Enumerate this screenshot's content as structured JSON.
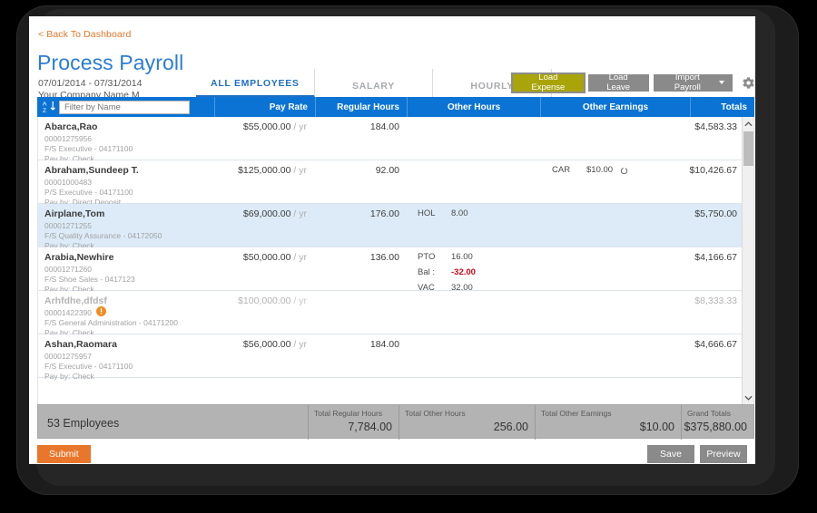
{
  "header": {
    "back_link": "< Back To Dashboard",
    "title": "Process Payroll",
    "date_range": "07/01/2014 - 07/31/2014",
    "company": "Your Company Name M"
  },
  "tabs": [
    {
      "label": "ALL EMPLOYEES",
      "active": true
    },
    {
      "label": "SALARY",
      "active": false
    },
    {
      "label": "HOURLY",
      "active": false
    }
  ],
  "actions": {
    "load_expense": "Load Expense",
    "load_leave": "Load Leave",
    "import_payroll": "Import Payroll",
    "gear": "gear-icon"
  },
  "filter": {
    "placeholder": "Filter by Name",
    "value": "",
    "sort_icon": "sort-alpha-down-icon"
  },
  "columns": [
    {
      "key": "name",
      "label": ""
    },
    {
      "key": "pay_rate",
      "label": "Pay Rate"
    },
    {
      "key": "regular_hours",
      "label": "Regular Hours"
    },
    {
      "key": "other_hours",
      "label": "Other Hours"
    },
    {
      "key": "other_earnings",
      "label": "Other Earnings"
    },
    {
      "key": "totals",
      "label": "Totals"
    }
  ],
  "rows": [
    {
      "name": "Abarca,Rao",
      "emp_id": "00001275956",
      "dept": "F/S Executive - 04171100",
      "pay_by": "Pay by: Check",
      "pay_rate": "$55,000.00",
      "pay_unit": "/ yr",
      "regular_hours": "184.00",
      "other_hours": [],
      "other_earnings": [],
      "total": "$4,583.33",
      "selected": false,
      "disabled": false,
      "warning": false
    },
    {
      "name": "Abraham,Sundeep T.",
      "emp_id": "00001000483",
      "dept": "P/S Executive - 04171100",
      "pay_by": "Pay by: Direct Deposit",
      "pay_rate": "$125,000.00",
      "pay_unit": "/ yr",
      "regular_hours": "92.00",
      "other_hours": [],
      "other_earnings": [
        {
          "code": "CAR",
          "value": "$10.00",
          "recurring": true
        }
      ],
      "total": "$10,426.67",
      "selected": false,
      "disabled": false,
      "warning": false
    },
    {
      "name": "Airplane,Tom",
      "emp_id": "00001271255",
      "dept": "F/S Quality Assurance - 04172050",
      "pay_by": "Pay by: Check",
      "pay_rate": "$69,000.00",
      "pay_unit": "/ yr",
      "regular_hours": "176.00",
      "other_hours": [
        {
          "code": "HOL",
          "value": "8.00",
          "negative": false
        }
      ],
      "other_earnings": [],
      "total": "$5,750.00",
      "selected": true,
      "disabled": false,
      "warning": false
    },
    {
      "name": "Arabia,Newhire",
      "emp_id": "00001271260",
      "dept": "F/S Shoe Sales - 0417123",
      "pay_by": "Pay by: Check",
      "pay_rate": "$50,000.00",
      "pay_unit": "/ yr",
      "regular_hours": "136.00",
      "other_hours": [
        {
          "code": "PTO",
          "value": "16.00",
          "negative": false
        },
        {
          "code": "Bal :",
          "value": "-32.00",
          "negative": true
        },
        {
          "code": "VAC",
          "value": "32.00",
          "negative": false
        }
      ],
      "other_earnings": [],
      "total": "$4,166.67",
      "selected": false,
      "disabled": false,
      "warning": false
    },
    {
      "name": "Arhfdhe,dfdsf",
      "emp_id": "00001422390",
      "dept": "F/S General Administration - 04171200",
      "pay_by": "Pay by: Check",
      "pay_rate": "$100,000.00",
      "pay_unit": "/ yr",
      "regular_hours": "",
      "other_hours": [],
      "other_earnings": [],
      "total": "$8,333.33",
      "selected": false,
      "disabled": true,
      "warning": true
    },
    {
      "name": "Ashan,Raomara",
      "emp_id": "00001275957",
      "dept": "F/S Executive - 04171100",
      "pay_by": "Pay by: Check",
      "pay_rate": "$56,000.00",
      "pay_unit": "/ yr",
      "regular_hours": "184.00",
      "other_hours": [],
      "other_earnings": [],
      "total": "$4,666.67",
      "selected": false,
      "disabled": false,
      "warning": false
    }
  ],
  "totals_bar": {
    "employee_count": "53 Employees",
    "cells": [
      {
        "label": "Total Regular Hours",
        "value": "7,784.00"
      },
      {
        "label": "Total Other Hours",
        "value": "256.00"
      },
      {
        "label": "Total Other Earnings",
        "value": "$10.00"
      },
      {
        "label": "Grand Totals",
        "value": "$375,880.00"
      }
    ]
  },
  "footer_buttons": {
    "submit": "Submit",
    "save": "Save",
    "preview": "Preview"
  },
  "colors": {
    "brand_blue": "#0b73d4",
    "title_blue": "#2b7cd3",
    "accent_orange": "#e8762b",
    "expense_olive": "#a9a40a",
    "grey_button": "#8a8a8a",
    "selected_row": "#dcebf7",
    "negative_red": "#d0021b",
    "warning_orange": "#f08c1e"
  }
}
